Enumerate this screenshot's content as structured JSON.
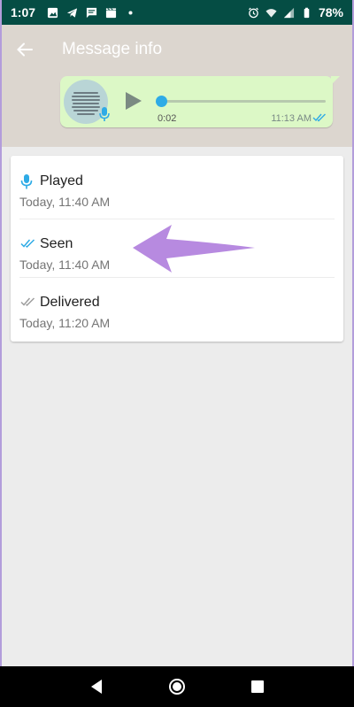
{
  "status_bar": {
    "time": "1:07",
    "battery": "78%"
  },
  "app_bar": {
    "title": "Message info"
  },
  "message": {
    "duration": "0:02",
    "time": "11:13 AM"
  },
  "receipts": [
    {
      "label": "Played",
      "time": "Today, 11:40 AM",
      "icon": "mic-icon"
    },
    {
      "label": "Seen",
      "time": "Today, 11:40 AM",
      "icon": "double-check-blue-icon"
    },
    {
      "label": "Delivered",
      "time": "Today, 11:20 AM",
      "icon": "double-check-grey-icon"
    }
  ],
  "colors": {
    "status_bar": "#054d44",
    "bubble": "#dcf8c6",
    "accent_blue": "#2eabe6",
    "arrow": "#b78ae0"
  }
}
